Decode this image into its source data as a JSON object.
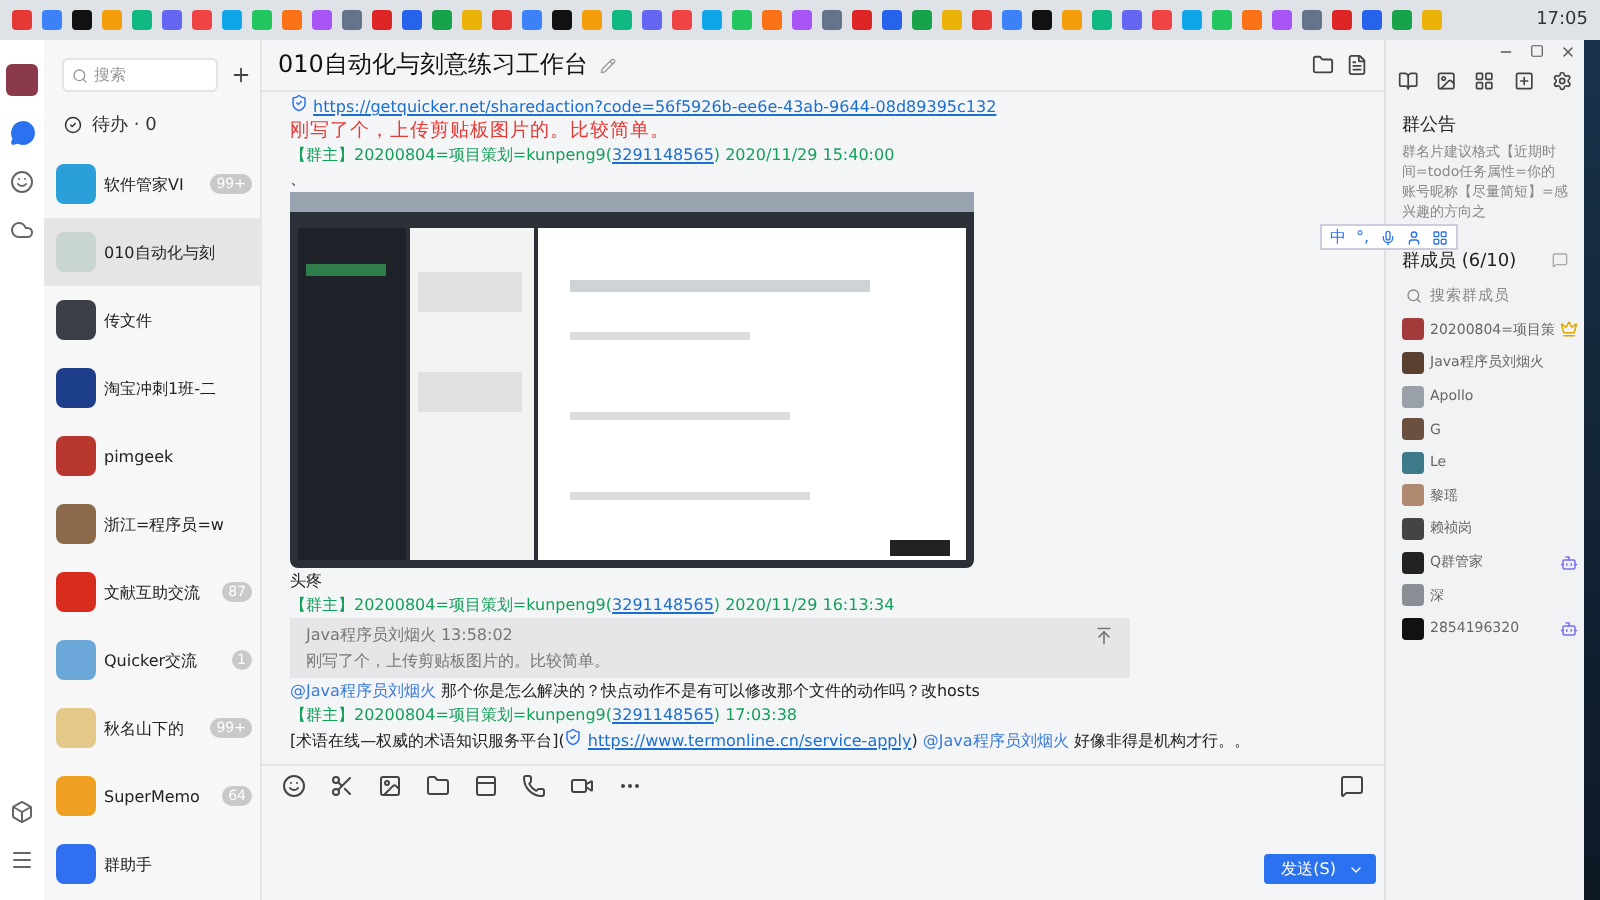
{
  "status_bar": {
    "time": "17:05"
  },
  "sidebar": {
    "search": {
      "placeholder": "搜索"
    },
    "todo": "待办 · 0",
    "items": [
      {
        "name": "软件管家VI",
        "badge": "99+",
        "color": "#2a9fd8",
        "selected": false
      },
      {
        "name": "010自动化与刻",
        "color": "#c9d6cf",
        "selected": true
      },
      {
        "name": "传文件",
        "color": "#3b3f45",
        "selected": false
      },
      {
        "name": "淘宝冲刺1班-二",
        "color": "#1d3f8a",
        "selected": false
      },
      {
        "name": "pimgeek",
        "color": "#b7372f",
        "selected": false
      },
      {
        "name": "浙江=程序员=w",
        "color": "#8a6a4a",
        "selected": false
      },
      {
        "name": "文献互助交流",
        "badge": "87",
        "color": "#d82c1f",
        "selected": false
      },
      {
        "name": "Quicker交流",
        "badge": "1",
        "color": "#6aa6d8",
        "selected": false
      },
      {
        "name": "秋名山下的",
        "badge": "99+",
        "color": "#e3c88a",
        "selected": false
      },
      {
        "name": "SuperMemo",
        "badge": "64",
        "color": "#f0a020",
        "selected": false
      },
      {
        "name": "群助手",
        "color": "#2f6ff0",
        "selected": false
      }
    ]
  },
  "chat": {
    "title": "010自动化与刻意练习工作台",
    "messages": [
      {
        "kind": "link",
        "text": "https://getquicker.net/sharedaction?code=56f5926b-ee6e-43ab-9644-08d89395c132"
      },
      {
        "kind": "alert",
        "text": "刚写了个，上传剪贴板图片的。比较简单。"
      },
      {
        "kind": "header",
        "role": "【群主】",
        "sender": "20200804=项目策划=kunpeng9(",
        "qq": "3291148565",
        "time": ") 2020/11/29 15:40:00"
      },
      {
        "kind": "text",
        "text": "、"
      },
      {
        "kind": "picture"
      },
      {
        "kind": "text",
        "text": "头疼"
      },
      {
        "kind": "header",
        "role": "【群主】",
        "sender": "20200804=项目策划=kunpeng9(",
        "qq": "3291148565",
        "time": ") 2020/11/29 16:13:34"
      },
      {
        "kind": "quote",
        "author": "Java程序员刘烟火",
        "time": "13:58:02",
        "text": "刚写了个，上传剪贴板图片的。比较简单。"
      },
      {
        "kind": "mention",
        "mention": "@Java程序员刘烟火",
        "text": " 那个你是怎么解决的？快点动作不是有可以修改那个文件的动作吗？改hosts"
      },
      {
        "kind": "header",
        "role": "【群主】",
        "sender": "20200804=项目策划=kunpeng9(",
        "qq": "3291148565",
        "time": ")  17:03:38"
      },
      {
        "kind": "rich",
        "before": "[术语在线—权威的术语知识服务平台](",
        "link": "https://www.termonline.cn/service-apply",
        "after": ")",
        "mention": "@Java程序员刘烟火",
        "text": " 好像非得是机构才行。。"
      }
    ],
    "send": "发送(S)"
  },
  "ime": {
    "mode": "中",
    "punct": "°,"
  },
  "panel": {
    "notice_title": "群公告",
    "notice": "群名片建议格式【近期时间=todo任务属性=你的账号昵称【尽量简短】=感兴趣的方向之",
    "members_title": "群成员 (6/10)",
    "search": {
      "placeholder": "搜索群成员"
    },
    "members": [
      {
        "name": "20200804=项目策",
        "kind": "owner",
        "color": "#a33b3b"
      },
      {
        "name": "Java程序员刘烟火",
        "kind": "member",
        "color": "#5a4030"
      },
      {
        "name": "Apollo",
        "kind": "member",
        "color": "#9aa0a8"
      },
      {
        "name": "G",
        "kind": "member",
        "color": "#6b5040"
      },
      {
        "name": "Le",
        "kind": "member",
        "color": "#3d7a8a"
      },
      {
        "name": "黎瑶",
        "kind": "member",
        "color": "#b08a70"
      },
      {
        "name": "赖祯岗",
        "kind": "member",
        "color": "#444444"
      },
      {
        "name": "Q群管家",
        "kind": "bot",
        "color": "#222222"
      },
      {
        "name": "深",
        "kind": "member",
        "color": "#8a8f96"
      },
      {
        "name": "2854196320",
        "kind": "bot",
        "color": "#111111"
      }
    ]
  }
}
